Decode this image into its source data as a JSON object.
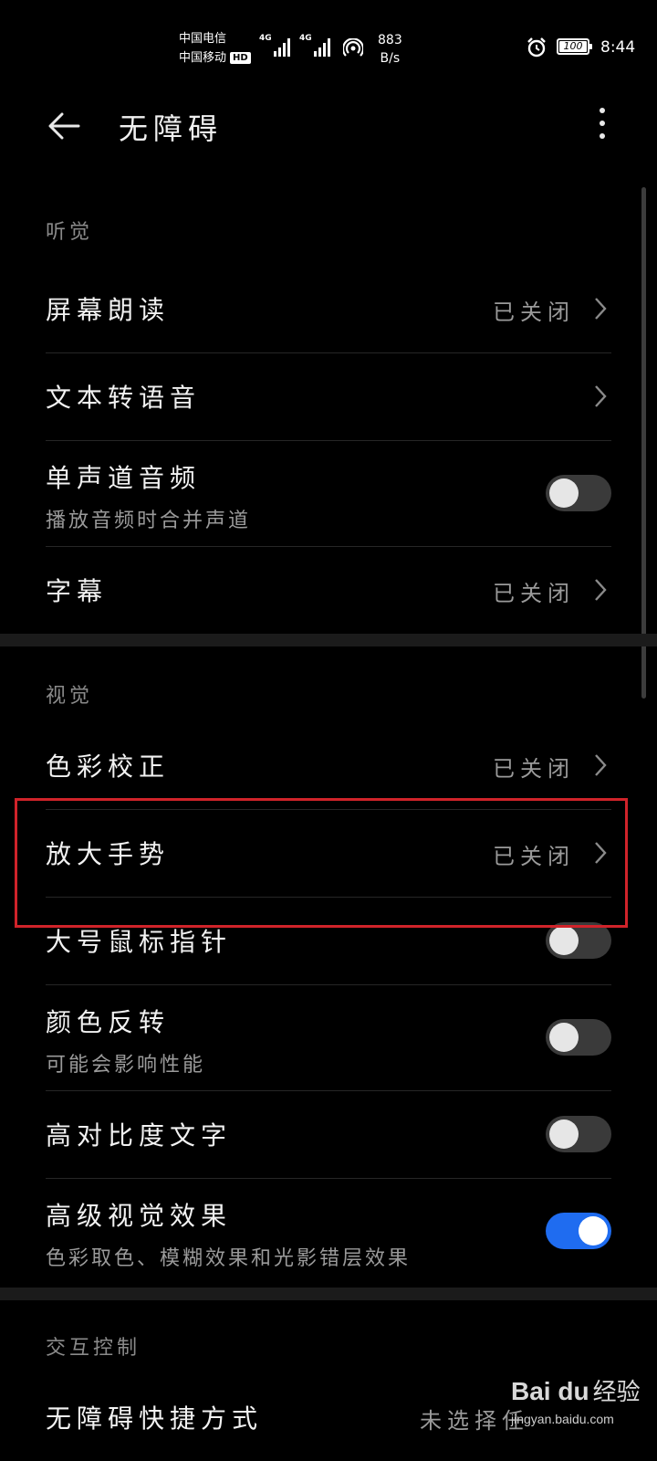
{
  "status_bar": {
    "carrier_1": "中国电信",
    "carrier_2": "中国移动",
    "hd_badge": "HD",
    "signal_1_label": "4G",
    "signal_2_label": "4G",
    "net_speed_value": "883",
    "net_speed_unit": "B/s",
    "battery_level": "100",
    "time": "8:44"
  },
  "app_bar": {
    "title": "无障碍"
  },
  "sections": {
    "hearing": {
      "title": "听觉",
      "items": [
        {
          "label": "屏幕朗读",
          "value": "已关闭"
        },
        {
          "label": "文本转语音"
        },
        {
          "label": "单声道音频",
          "sub": "播放音频时合并声道",
          "toggle_on": false
        },
        {
          "label": "字幕",
          "value": "已关闭"
        }
      ]
    },
    "vision": {
      "title": "视觉",
      "items": [
        {
          "label": "色彩校正",
          "value": "已关闭"
        },
        {
          "label": "放大手势",
          "value": "已关闭"
        },
        {
          "label": "大号鼠标指针",
          "toggle_on": false
        },
        {
          "label": "颜色反转",
          "sub": "可能会影响性能",
          "toggle_on": false
        },
        {
          "label": "高对比度文字",
          "toggle_on": false
        },
        {
          "label": "高级视觉效果",
          "sub": "色彩取色、模糊效果和光影错层效果",
          "toggle_on": true
        }
      ]
    },
    "interaction": {
      "title": "交互控制",
      "items": [
        {
          "label": "无障碍快捷方式",
          "value": "未选择任"
        }
      ]
    }
  },
  "watermark": {
    "logo": "Bai du",
    "text": "经验",
    "url": "jingyan.baidu.com"
  },
  "colors": {
    "toggle_on": "#1f6cf0",
    "highlight_border": "#d0232a"
  }
}
